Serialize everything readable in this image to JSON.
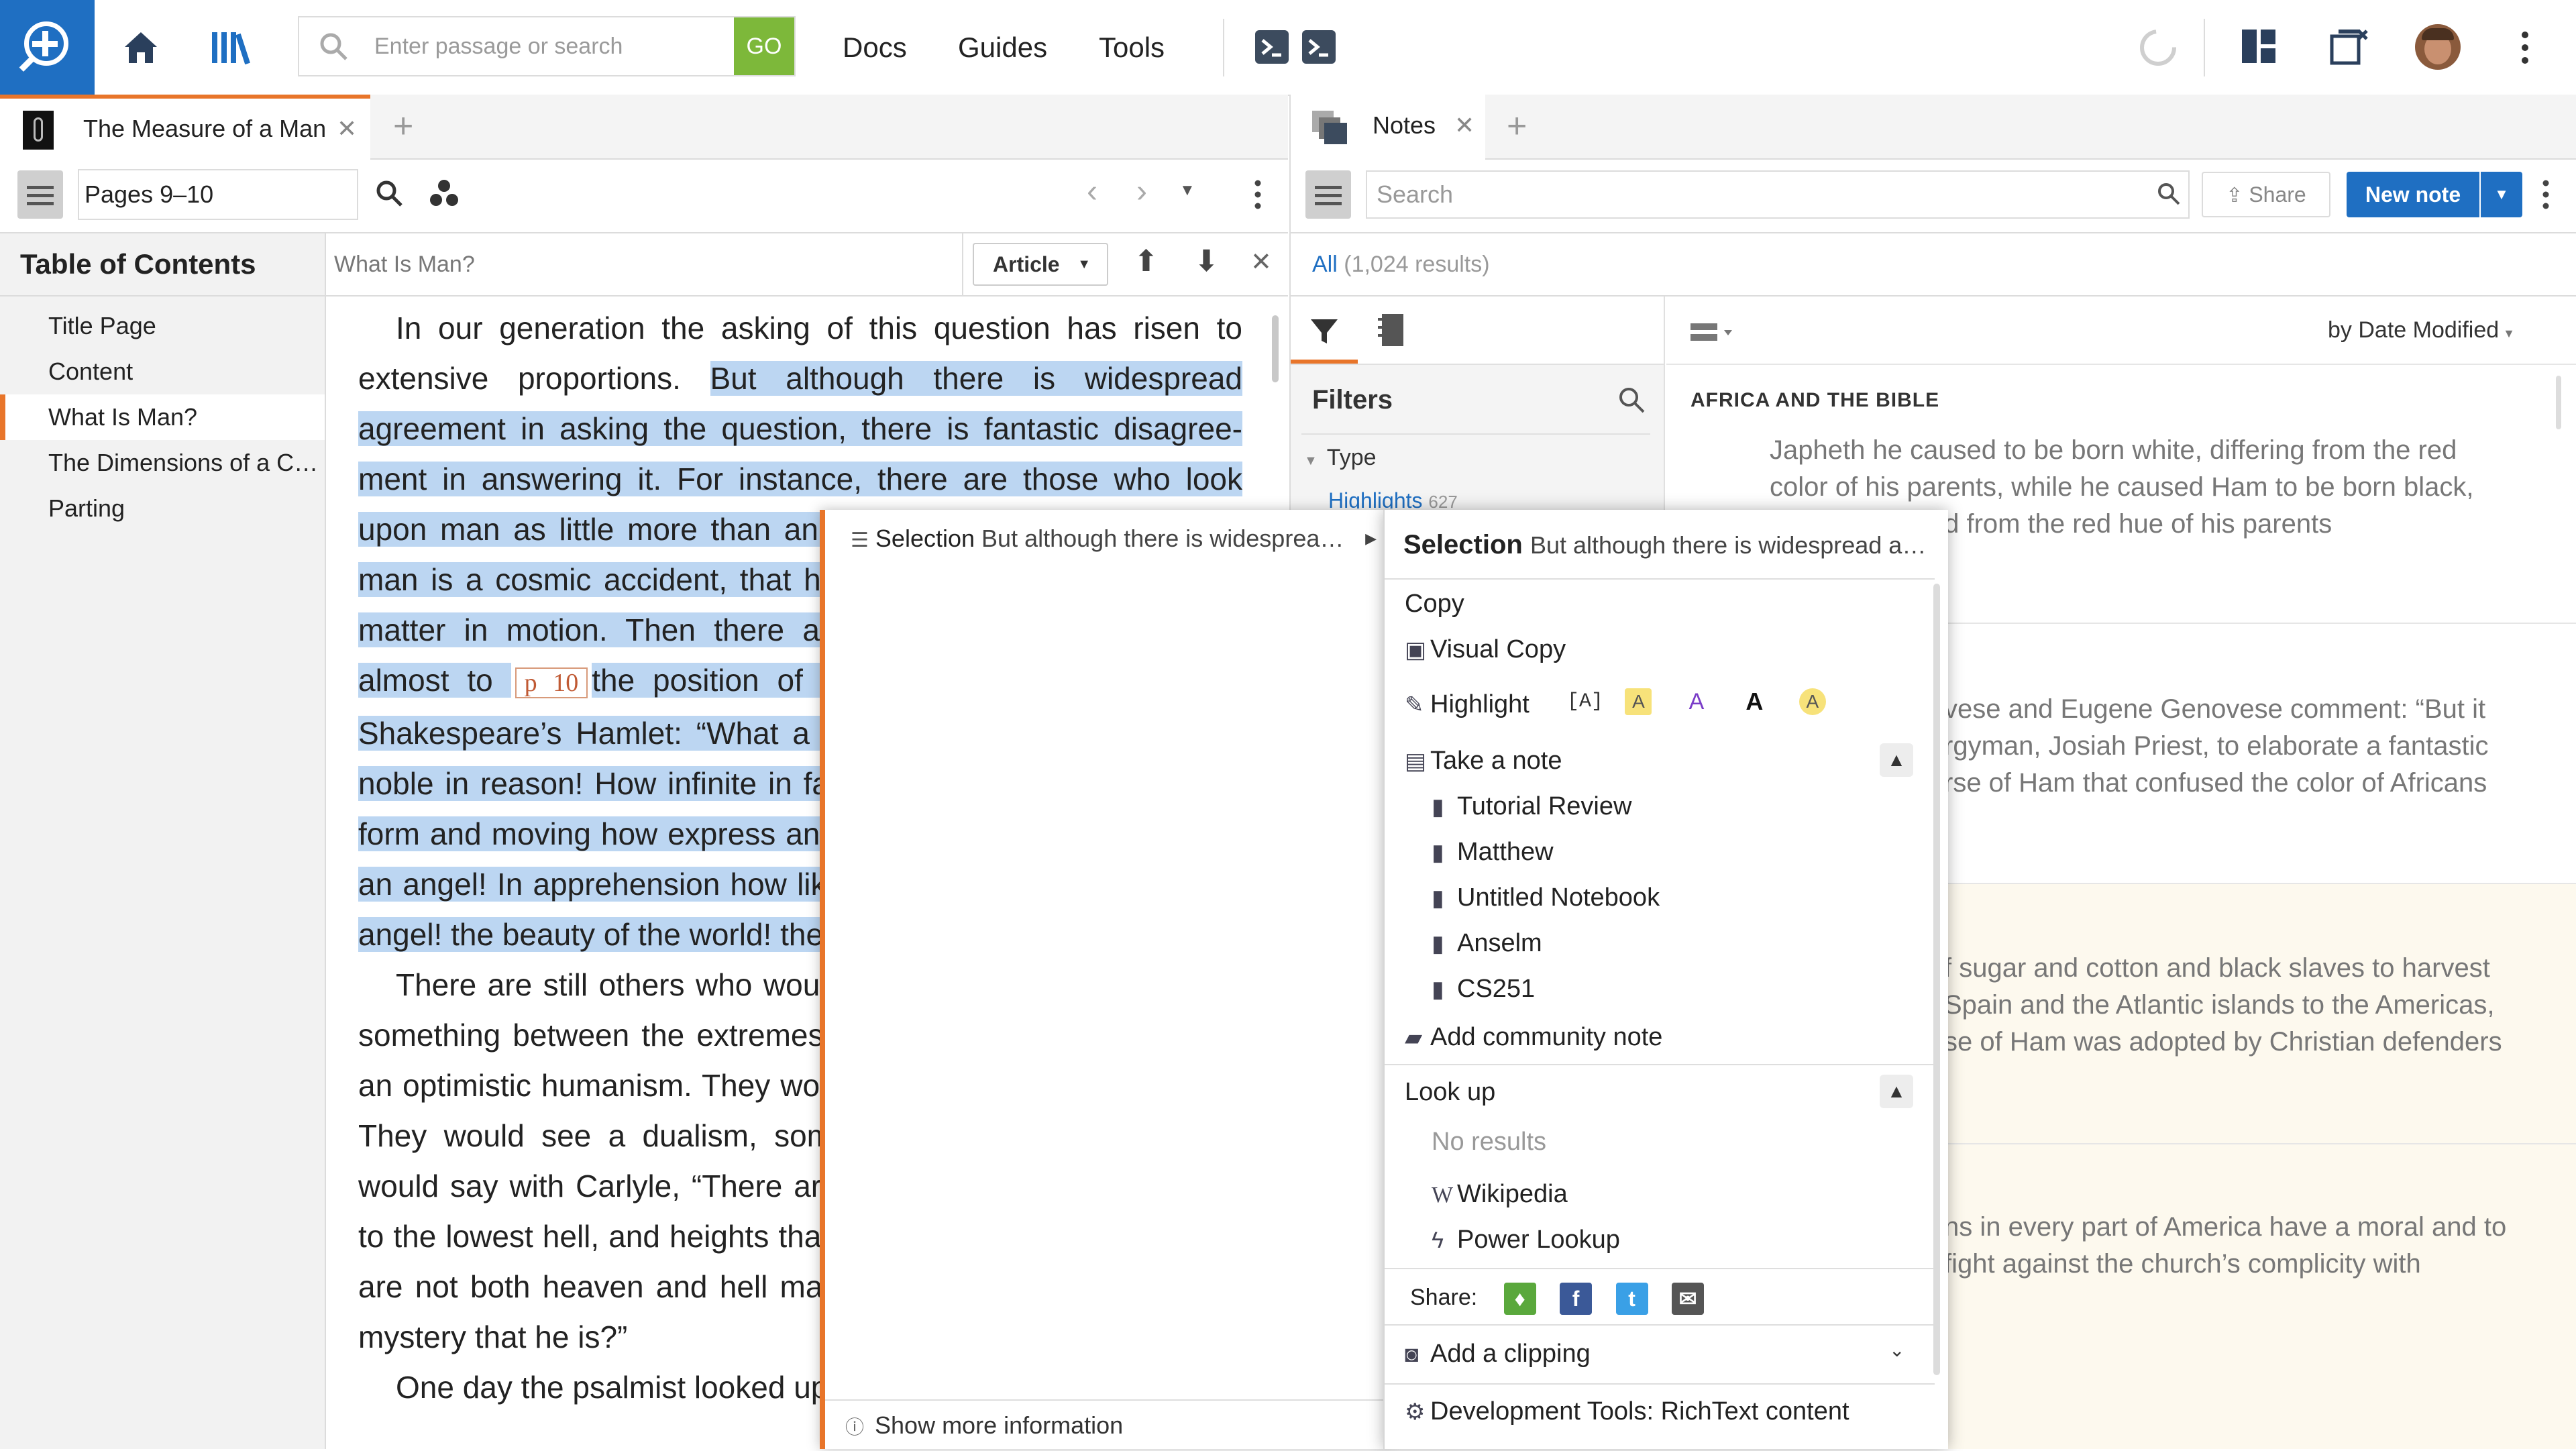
{
  "topbar": {
    "search_placeholder": "Enter passage or search",
    "go_label": "GO",
    "nav": [
      "Docs",
      "Guides",
      "Tools"
    ]
  },
  "left_pane": {
    "tab_title": "The Measure of a Man",
    "reference": "Pages 9–10",
    "find_value": "What Is Man?",
    "find_mode": "Article",
    "toc_heading": "Table of Contents",
    "toc_items": [
      "Title Page",
      "Content",
      "What Is Man?",
      "The Dimensions of a C…",
      "Parting"
    ],
    "text": {
      "p1_a": "In our generation the asking of this question has risen to extensive proportions. ",
      "p1_hl_a": "But although there is widespread agreement in asking the question, there is fantastic disagree­ment in answering it. For instance, there are those who look upon man as little more than an animal. They would hold that man is a cosmic accident, that his life is a mere expression of matter in motion. Then there are those who would lift man almost to",
      "page_marker": "p 10",
      "p1_hl_b": "the position of God. They would agree with Shakespeare’s Hamlet: “What a piece of work is a man! How noble in reason! How infinite in faculty! How noble in faculty! In form and moving how express and admirable! In action how like an angel! In apprehension how like a God; in action how like an angel! the beauty of the world! the paragon of animals.”",
      "p2": "There are still others who would take a more optimistic view, something between the extremes of pessimistic naturalism and an optimistic humanism. They would combine the truths of both. They would see a dualism, something of a dichotomy. They would say with Carlyle, “There are depths in man that go down to the lowest hell, and heights that reach the highest heaven, for are not both heaven and hell made out of him, this everlasting mystery that he is?”",
      "p3": "One day the psalmist looked up"
    }
  },
  "notes_pane": {
    "tab_title": "Notes",
    "search_placeholder": "Search",
    "share_label": "Share",
    "new_note_label": "New note",
    "all_label": "All",
    "results": "(1,024 results)",
    "filters_label": "Filters",
    "type_label": "Type",
    "highlights_label": "Highlights",
    "highlights_count": "627",
    "sort_label": "by Date Modified",
    "cards": [
      {
        "heading": "AFRICA AND THE BIBLE",
        "text": "Japheth he caused to be born white, differing from the red color of his parents, while he caused Ham to be born black, further removed from the red hue of his parents"
      },
      {
        "heading": "",
        "text": "vese and Eugene Genovese comment: “But it rgyman, Josiah Priest, to elaborate a fantastic rse of Ham that confused the color of Africans"
      },
      {
        "heading": "",
        "text": "f sugar and cotton and black slaves to harvest Spain and the Atlantic islands to the Americas, se of Ham was adopted by Christian defenders"
      },
      {
        "heading": "",
        "text": "ns in every part of America have a moral and to fight against the church’s complicity with"
      }
    ]
  },
  "selection_popup": {
    "label": "Selection",
    "preview": "But although there is widesprea…",
    "more_info": "Show more information"
  },
  "context_menu": {
    "header_label": "Selection",
    "header_preview": "But although there is widespread a…",
    "copy": "Copy",
    "visual_copy": "Visual Copy",
    "highlight": "Highlight",
    "highlight_bracket": "[A]",
    "highlight_styles": [
      "A",
      "A",
      "A",
      "A"
    ],
    "take_note": "Take a note",
    "notebooks": [
      "Tutorial Review",
      "Matthew",
      "Untitled Notebook",
      "Anselm",
      "CS251"
    ],
    "add_community_note": "Add community note",
    "look_up": "Look up",
    "no_results": "No results",
    "wikipedia": "Wikipedia",
    "power_lookup": "Power Lookup",
    "share_label": "Share:",
    "add_clipping": "Add a clipping",
    "dev_tools": "Development Tools: RichText content"
  },
  "colors": {
    "accent_blue": "#1f6fc2",
    "go_green": "#7db83a",
    "selection_highlight": "#bcd6f2",
    "active_orange": "#e8752a"
  }
}
